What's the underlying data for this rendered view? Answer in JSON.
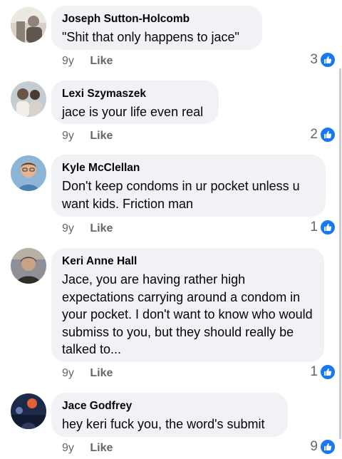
{
  "comments": [
    {
      "author": "Joseph Sutton-Holcomb",
      "text": "\"Shit that only happens to jace\"",
      "age": "9y",
      "like_label": "Like",
      "reactions": "3",
      "avatar_icon": "profile-photo",
      "avatar_colors": [
        "#cfc9c0",
        "#6b6259",
        "#e6e2dc"
      ]
    },
    {
      "author": "Lexi Szymaszek",
      "text": "jace is your life even real",
      "age": "9y",
      "like_label": "Like",
      "reactions": "2",
      "avatar_icon": "profile-photo",
      "avatar_colors": [
        "#b9c3c9",
        "#5c4a3f",
        "#e8e3dd"
      ]
    },
    {
      "author": "Kyle McClellan",
      "text": "Don't keep condoms in ur pocket unless u want kids.  Friction man",
      "age": "9y",
      "like_label": "Like",
      "reactions": "1",
      "avatar_icon": "profile-photo",
      "avatar_colors": [
        "#e9c3a1",
        "#5c4a3a",
        "#7aa6c9"
      ]
    },
    {
      "author": "Keri Anne Hall",
      "text": "Jace, you are having rather high expectations carrying around a condom in your pocket.  I don't want to know who would submiss to you, but they should really be talked to...",
      "age": "9y",
      "like_label": "Like",
      "reactions": "1",
      "avatar_icon": "profile-photo",
      "avatar_colors": [
        "#c7a48a",
        "#3d3935",
        "#8e9097"
      ]
    },
    {
      "author": "Jace Godfrey",
      "text": "hey keri fuck you, the word's submit",
      "age": "9y",
      "like_label": "Like",
      "reactions": "9",
      "avatar_icon": "profile-photo",
      "avatar_colors": [
        "#1d2a4a",
        "#d24a2a",
        "#6a7bb0"
      ]
    }
  ],
  "colors": {
    "bubble": "#f0f2f5",
    "meta_text": "#65676b",
    "like_badge": "#1877f2"
  }
}
